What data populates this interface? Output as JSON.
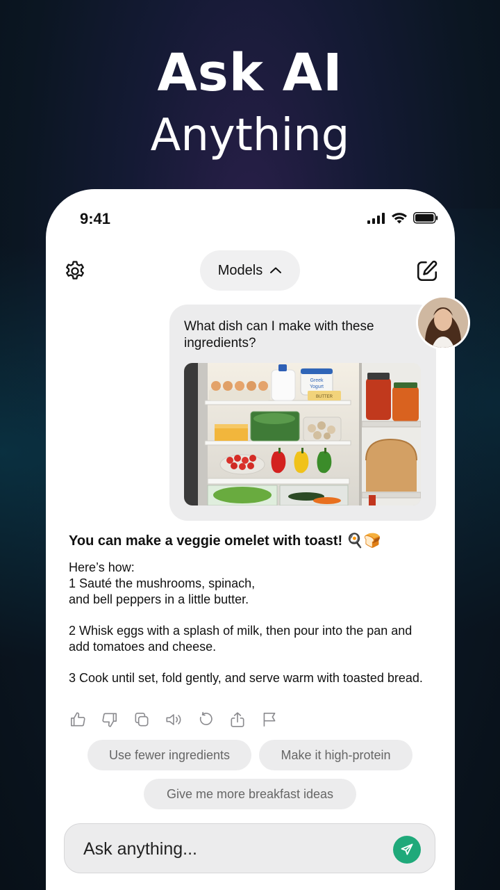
{
  "hero": {
    "title": "Ask AI",
    "subtitle": "Anything"
  },
  "status_bar": {
    "time": "9:41"
  },
  "top_bar": {
    "models_label": "Models"
  },
  "user_message": {
    "text": "What dish can I make with these ingredients?"
  },
  "assistant": {
    "title": "You can make a veggie omelet with toast! 🍳🍞",
    "intro": "Here’s how:",
    "step1_line1": "1 Sauté the mushrooms, spinach,",
    "step1_line2": "and bell peppers in a little butter.",
    "step2": "2 Whisk eggs with a splash of milk, then pour into the pan and add tomatoes and cheese.",
    "step3": "3 Cook until set, fold gently, and serve warm with toasted bread."
  },
  "fridge_labels": {
    "yogurt": "Greek Yogurt",
    "butter": "BUTTER"
  },
  "suggestions": [
    "Use fewer ingredients",
    "Make it high-protein",
    "Give me more breakfast ideas"
  ],
  "input": {
    "placeholder": "Ask anything..."
  },
  "colors": {
    "send_button": "#1fa97a",
    "bubble": "#ececed",
    "chip": "#ececed"
  },
  "icons": {
    "actions": [
      "thumbs-up-icon",
      "thumbs-down-icon",
      "copy-icon",
      "speaker-icon",
      "regenerate-icon",
      "share-icon",
      "flag-icon"
    ]
  }
}
